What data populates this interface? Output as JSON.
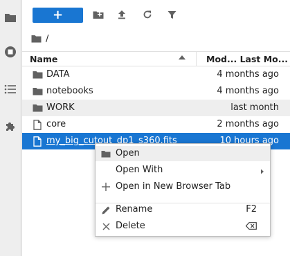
{
  "sidebar": {
    "items": [
      {
        "icon": "folder-icon"
      },
      {
        "icon": "running-icon"
      },
      {
        "icon": "list-icon"
      },
      {
        "icon": "extension-icon"
      }
    ]
  },
  "toolbar": {
    "new_label": "+",
    "icons": [
      "new-folder-icon",
      "upload-icon",
      "refresh-icon",
      "filter-icon"
    ]
  },
  "breadcrumb": {
    "path": "/"
  },
  "header": {
    "name": "Name",
    "modified": "Mod... Last Mo..."
  },
  "files": [
    {
      "name": "DATA",
      "type": "folder",
      "modified": "4 months ago"
    },
    {
      "name": "notebooks",
      "type": "folder",
      "modified": "4 months ago"
    },
    {
      "name": "WORK",
      "type": "folder",
      "modified": "last month"
    },
    {
      "name": "core",
      "type": "file",
      "modified": "2 months ago"
    },
    {
      "name": "my_big_cutout_dp1_s360.fits",
      "type": "file",
      "modified": "10 hours ago"
    }
  ],
  "context_menu": {
    "items": [
      {
        "label": "Open",
        "shortcut": "",
        "icon": "folder-icon"
      },
      {
        "label": "Open With",
        "shortcut": "",
        "icon": "chevron-right-icon"
      },
      {
        "label": "Open in New Browser Tab",
        "shortcut": "",
        "icon": "plus-icon"
      },
      {
        "label": "Rename",
        "shortcut": "F2",
        "icon": "pencil-icon"
      },
      {
        "label": "Delete",
        "shortcut": "",
        "icon": "close-icon"
      }
    ]
  },
  "colors": {
    "accent": "#1976d2",
    "sidebar_bg": "#eeeeee",
    "icon": "#616161"
  }
}
